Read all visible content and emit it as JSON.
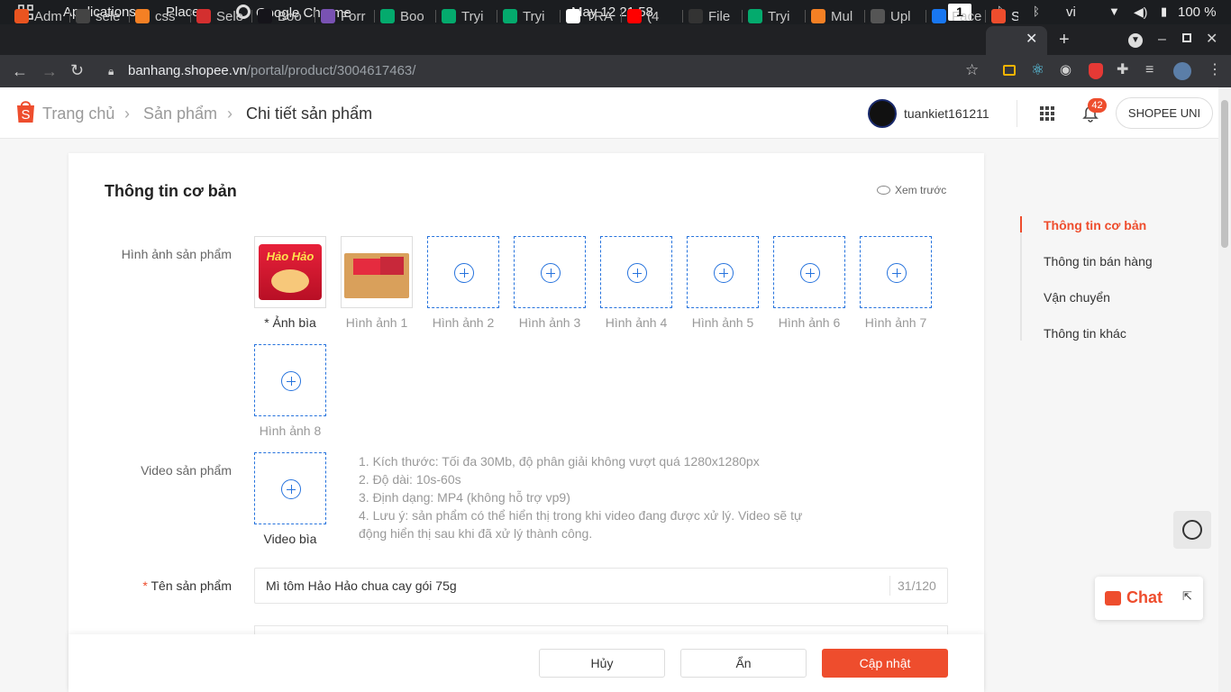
{
  "system_bar": {
    "applications": "Applications",
    "places": "Places",
    "chrome": "Google Chrome",
    "datetime": "May 12  21:58",
    "workspace": "1",
    "language": "vi",
    "battery": "100 %"
  },
  "tabs": [
    {
      "label": "Adm",
      "icon": "ubuntu-icon",
      "color": "#e95420"
    },
    {
      "label": "sele",
      "icon": "codepen-icon",
      "color": "#444444"
    },
    {
      "label": "css",
      "icon": "stackoverflow-icon",
      "color": "#f48024"
    },
    {
      "label": "Sele",
      "icon": "layers-icon",
      "color": "#d32f2f"
    },
    {
      "label": "Boo",
      "icon": "mdn-icon",
      "color": "#15141a"
    },
    {
      "label": "Forr",
      "icon": "bootstrap-icon",
      "color": "#7952b3"
    },
    {
      "label": "Boo",
      "icon": "w3schools-icon",
      "color": "#04aa6d"
    },
    {
      "label": "Tryi",
      "icon": "w3schools-icon",
      "color": "#04aa6d"
    },
    {
      "label": "Tryi",
      "icon": "w3schools-icon",
      "color": "#04aa6d"
    },
    {
      "label": "TRA",
      "icon": "google-icon",
      "color": "#ffffff"
    },
    {
      "label": "(4",
      "icon": "youtube-icon",
      "color": "#ff0000"
    },
    {
      "label": "File",
      "icon": "scribd-icon",
      "color": "#333333"
    },
    {
      "label": "Tryi",
      "icon": "w3schools-icon",
      "color": "#04aa6d"
    },
    {
      "label": "Mul",
      "icon": "stackoverflow-icon",
      "color": "#f48024"
    },
    {
      "label": "Upl",
      "icon": "tm-icon",
      "color": "#555555"
    },
    {
      "label": "Face",
      "icon": "facebook-icon",
      "color": "#1877f2"
    },
    {
      "label": "S",
      "icon": "shopee-icon",
      "color": "#ee4d2d"
    }
  ],
  "address": {
    "domain": "banhang.shopee.vn",
    "path": "/portal/product/3004617463/"
  },
  "header": {
    "breadcrumb": [
      "Trang chủ",
      "Sản phẩm",
      "Chi tiết sản phẩm"
    ],
    "username": "tuankiet161211",
    "notif_count": "42",
    "shopee_uni": "SHOPEE UNI"
  },
  "form": {
    "section_title": "Thông tin cơ bản",
    "preview": "Xem trước",
    "images_label": "Hình ảnh sản phẩm",
    "cover_caption": "Ảnh bìa",
    "image_captions": [
      "Hình ảnh 1",
      "Hình ảnh 2",
      "Hình ảnh 3",
      "Hình ảnh 4",
      "Hình ảnh 5",
      "Hình ảnh 6",
      "Hình ảnh 7",
      "Hình ảnh 8"
    ],
    "product_image_text": "Hảo Hảo",
    "video_label": "Video sản phẩm",
    "video_caption": "Video bìa",
    "video_hints": [
      "1. Kích thước: Tối đa 30Mb, độ phân giải không vượt quá 1280x1280px",
      "2. Độ dài: 10s-60s",
      "3. Định dạng: MP4 (không hỗ trợ vp9)",
      "4. Lưu ý: sản phẩm có thể hiển thị trong khi video đang được xử lý. Video sẽ tự",
      "động hiển thị sau khi đã xử lý thành công."
    ],
    "name_label": "Tên sản phẩm",
    "name_value": "Mì tôm Hảo Hảo chua cay gói 75g",
    "name_count": "31/120"
  },
  "side_nav": [
    "Thông tin cơ bản",
    "Thông tin bán hàng",
    "Vận chuyển",
    "Thông tin khác"
  ],
  "footer": {
    "cancel": "Hủy",
    "hide": "Ẩn",
    "update": "Cập nhật"
  },
  "chat_label": "Chat",
  "colors": {
    "brand": "#ee4d2d",
    "link": "#2673dd"
  }
}
